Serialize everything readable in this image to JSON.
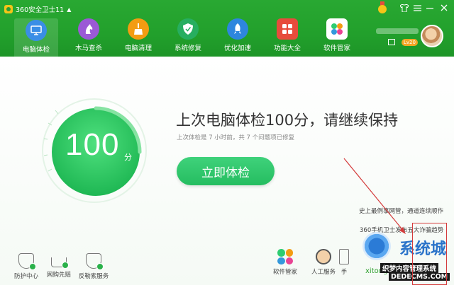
{
  "window": {
    "title": "360安全卫士11",
    "controls": [
      "shirt-icon",
      "menu-icon",
      "minimize-icon",
      "close-icon"
    ]
  },
  "nav": {
    "items": [
      {
        "label": "电脑体检",
        "icon": "monitor-icon",
        "color": "#3a8ee6"
      },
      {
        "label": "木马查杀",
        "icon": "horse-icon",
        "color": "#9b59d6"
      },
      {
        "label": "电脑清理",
        "icon": "broom-icon",
        "color": "#f39c12"
      },
      {
        "label": "系统修复",
        "icon": "shield-icon",
        "color": "#27ae60"
      },
      {
        "label": "优化加速",
        "icon": "rocket-icon",
        "color": "#2e86de"
      },
      {
        "label": "功能大全",
        "icon": "grid-icon",
        "color": "#e74c3c"
      },
      {
        "label": "软件管家",
        "icon": "software-icon",
        "color": "#16a085"
      }
    ]
  },
  "user": {
    "level": "Lv20"
  },
  "main": {
    "score": "100",
    "score_unit": "分",
    "headline": "上次电脑体检100分，请继续保持",
    "subline": "上次体检是 7 小时前，共 7 个问题项已修复",
    "button": "立即体检"
  },
  "news": [
    "史上最例事网管，通道连续顺作",
    "360手机卫士发布五大诈骗趋势"
  ],
  "bottom_left": [
    {
      "label": "防护中心"
    },
    {
      "label": "网购先赔"
    },
    {
      "label": "反勒索服务"
    }
  ],
  "bottom_right": [
    {
      "label": "软件管家"
    },
    {
      "label": "人工服务"
    },
    {
      "label": "手"
    }
  ],
  "watermark": {
    "brand": "系统城",
    "domain": "xitongcheng.com",
    "site_line": "织梦内容管理系统",
    "site_url": "DEDECMS.COM"
  }
}
